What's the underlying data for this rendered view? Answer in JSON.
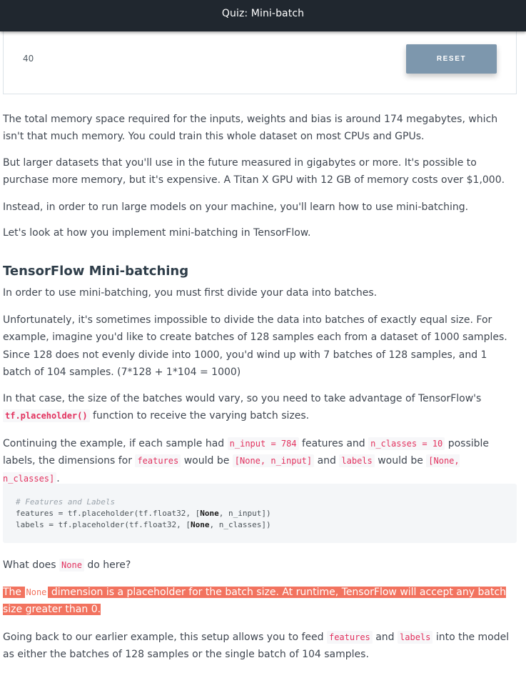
{
  "header": {
    "title": "Quiz: Mini-batch"
  },
  "quiz": {
    "value": "40",
    "reset_label": "RESET"
  },
  "paragraphs": {
    "p1": "The total memory space required for the inputs, weights and bias is around 174 megabytes, which isn't that much memory. You could train this whole dataset on most CPUs and GPUs.",
    "p2": "But larger datasets that you'll use in the future measured in gigabytes or more. It's possible to purchase more memory, but it's expensive. A Titan X GPU with 12 GB of memory costs over $1,000.",
    "p3": "Instead, in order to run large models on your machine, you'll learn how to use mini-batching.",
    "p4": "Let's look at how you implement mini-batching in TensorFlow.",
    "p5": "In order to use mini-batching, you must first divide your data into batches.",
    "p6": "Unfortunately, it's sometimes impossible to divide the data into batches of exactly equal size. For example, imagine you'd like to create batches of 128 samples each from a dataset of 1000 samples. Since 128 does not evenly divide into 1000, you'd wind up with 7 batches of 128 samples, and 1 batch of 104 samples. (7*128 + 1*104 = 1000)"
  },
  "heading": "TensorFlow Mini-batching",
  "p7": {
    "before": "In that case, the size of the batches would vary, so you need to take advantage of TensorFlow's ",
    "code": "tf.placeholder()",
    "after": " function to receive the varying batch sizes."
  },
  "p8": {
    "t1": "Continuing the example, if each sample had ",
    "c1": "n_input = 784",
    "t2": " features and ",
    "c2": "n_classes = 10",
    "t3": " possible labels, the dimensions for ",
    "c3": "features",
    "t4": " would be ",
    "c4": "[None, n_input]",
    "t5": " and ",
    "c5": "labels",
    "t6": " would be ",
    "c6": "[None, n_classes]",
    "t7": "."
  },
  "code_block": {
    "comment": "# Features and Labels",
    "line2_a": "features = tf.placeholder(tf.float32, [",
    "line2_kw": "None",
    "line2_b": ", n_input])",
    "line3_a": "labels = tf.placeholder(tf.float32, [",
    "line3_kw": "None",
    "line3_b": ", n_classes])"
  },
  "question": {
    "before": "What does ",
    "code": "None",
    "after": " do here?"
  },
  "answer": {
    "before": "The ",
    "code": "None",
    "after": " dimension is a placeholder for the batch size. At runtime, TensorFlow will accept any batch size greater than 0."
  },
  "p_last": {
    "t1": "Going back to our earlier example, this setup allows you to feed ",
    "c1": "features",
    "t2": " and ",
    "c2": "labels",
    "t3": " into the model as either the batches of 128 samples or the single batch of 104 samples."
  },
  "colors": {
    "topbar": "#20272f",
    "button": "#7d97ad",
    "inline_code": "#e2315e",
    "highlight": "#f2735f"
  }
}
